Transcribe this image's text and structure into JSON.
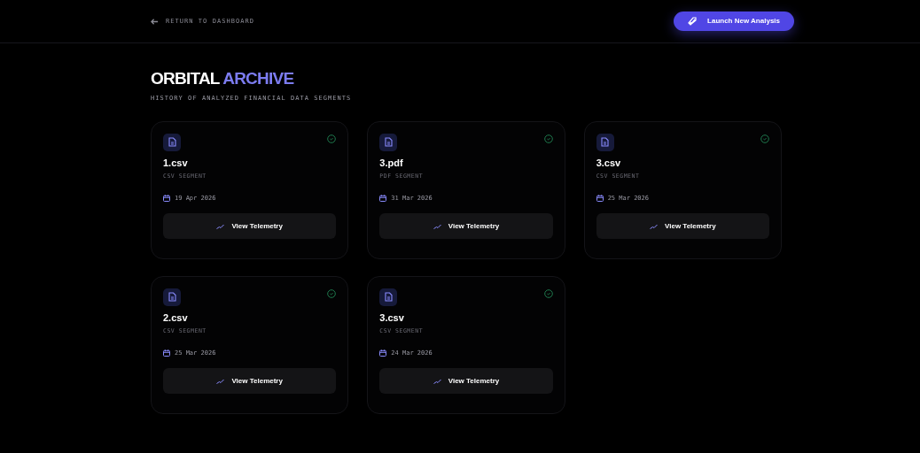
{
  "header": {
    "back_link": "RETURN TO DASHBOARD",
    "action_button": "Launch New Analysis"
  },
  "title": {
    "main": "ORBITAL",
    "accent": "ARCHIVE"
  },
  "subtitle": "HISTORY OF ANALYZED FINANCIAL DATA SEGMENTS",
  "cards": [
    {
      "name": "1.csv",
      "segment": "CSV SEGMENT",
      "date": "19 Apr 2026",
      "button": "View Telemetry"
    },
    {
      "name": "3.pdf",
      "segment": "PDF SEGMENT",
      "date": "31 Mar 2026",
      "button": "View Telemetry"
    },
    {
      "name": "3.csv",
      "segment": "CSV SEGMENT",
      "date": "25 Mar 2026",
      "button": "View Telemetry"
    },
    {
      "name": "2.csv",
      "segment": "CSV SEGMENT",
      "date": "25 Mar 2026",
      "button": "View Telemetry"
    },
    {
      "name": "3.csv",
      "segment": "CSV SEGMENT",
      "date": "24 Mar 2026",
      "button": "View Telemetry"
    }
  ]
}
